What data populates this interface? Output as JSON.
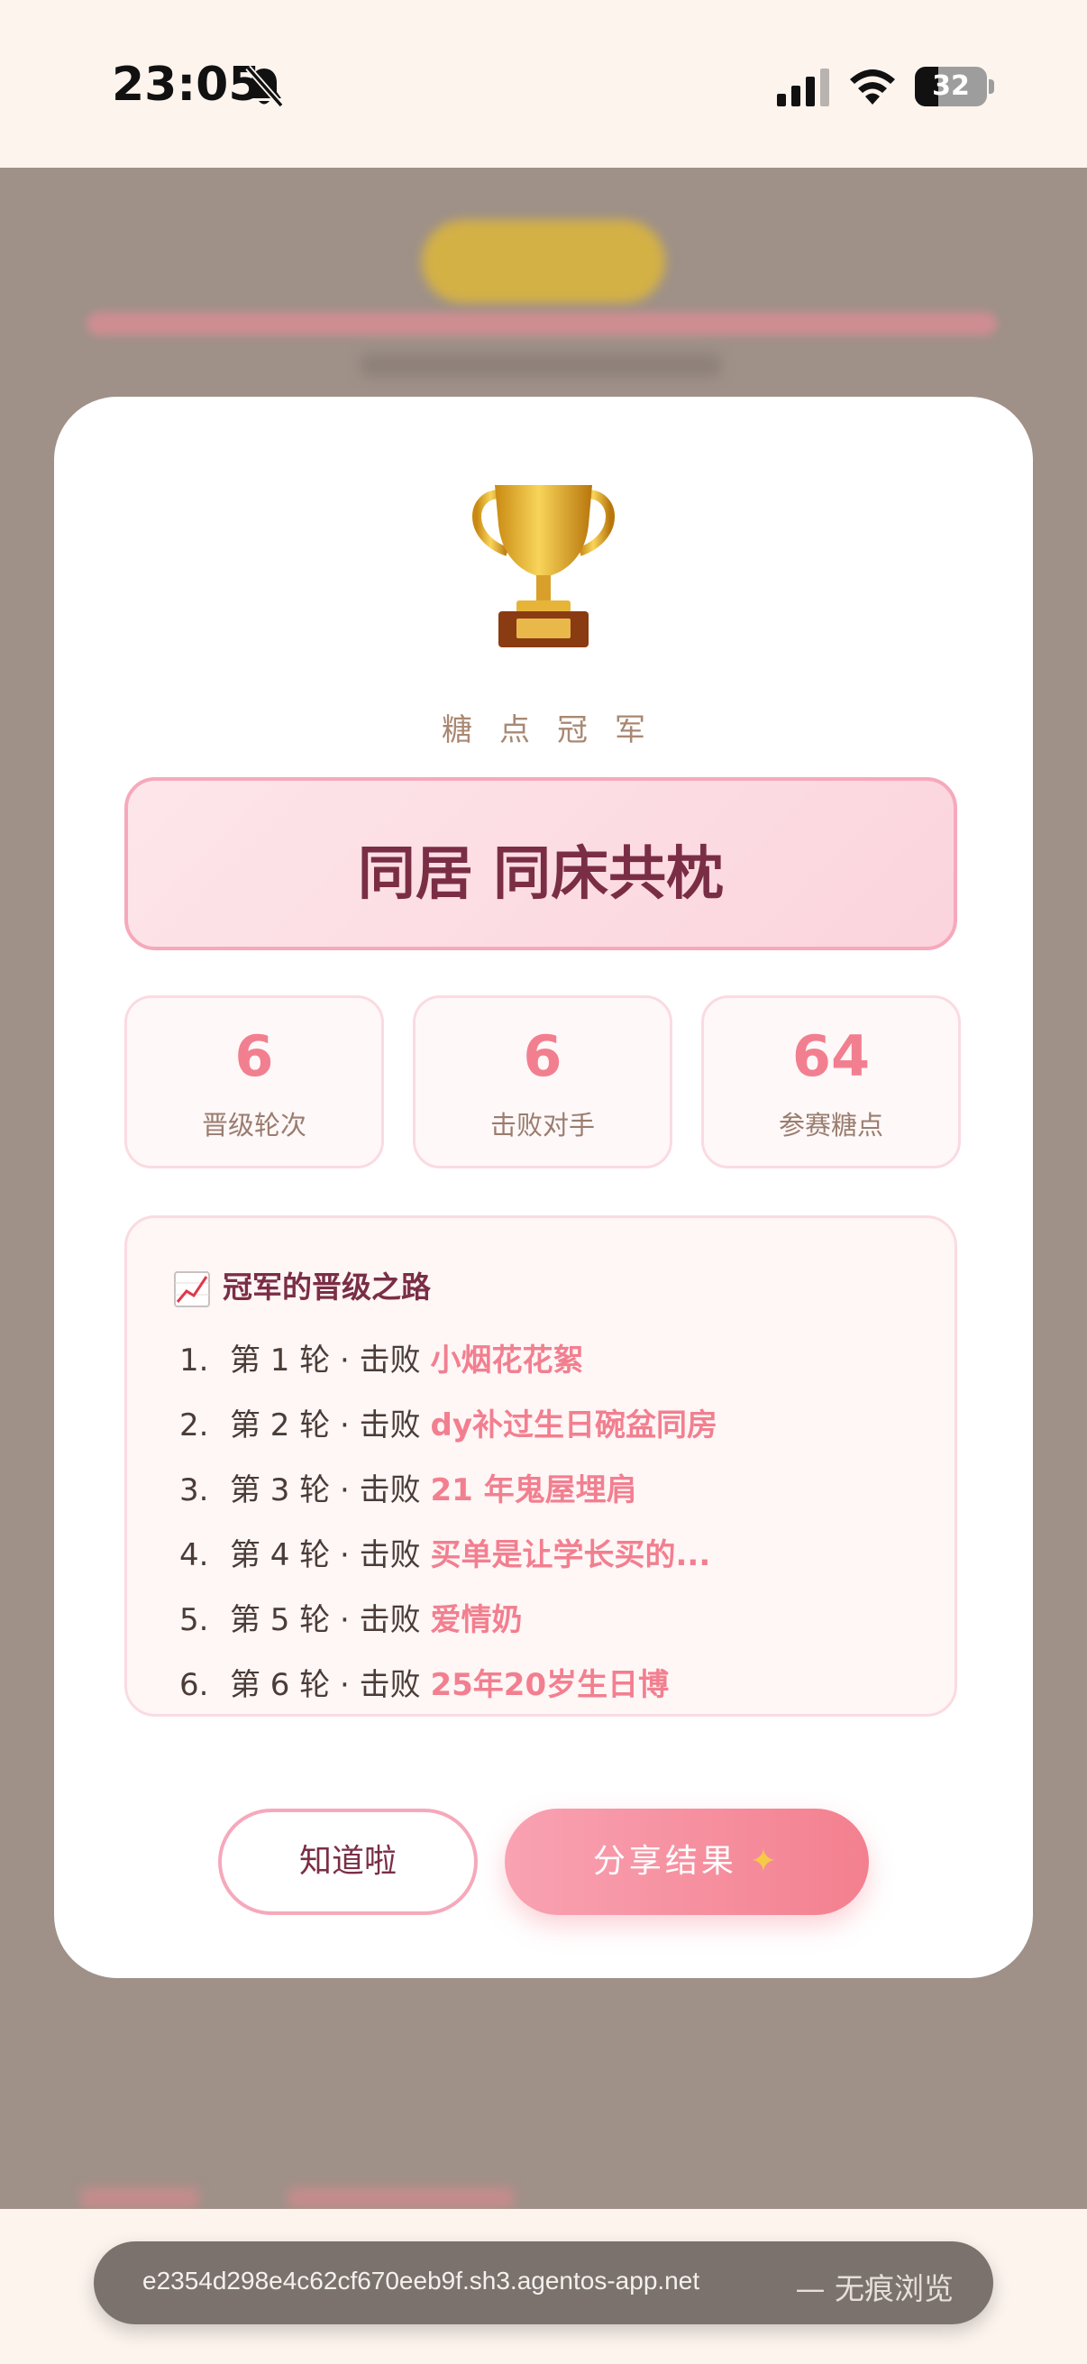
{
  "status_bar": {
    "time": "23:05",
    "battery": "32",
    "icons": [
      "bell-slash-icon",
      "signal-icon",
      "wifi-icon",
      "battery-icon"
    ]
  },
  "modal": {
    "trophy_icon": "trophy-icon",
    "subtitle": "糖点冠军",
    "champion_name": "同居 同床共枕",
    "stats": [
      {
        "value": "6",
        "label": "晋级轮次"
      },
      {
        "value": "6",
        "label": "击败对手"
      },
      {
        "value": "64",
        "label": "参赛糖点"
      }
    ],
    "path": {
      "icon": "chart-increasing-icon",
      "title": "冠军的晋级之路",
      "rounds": [
        {
          "index": "1.",
          "text": "第 1 轮 · 击败",
          "opponent": "小烟花花絮"
        },
        {
          "index": "2.",
          "text": "第 2 轮 · 击败",
          "opponent": "dy补过生日碗盆同房"
        },
        {
          "index": "3.",
          "text": "第 3 轮 · 击败",
          "opponent": "21 年鬼屋埋肩"
        },
        {
          "index": "4.",
          "text": "第 4 轮 · 击败",
          "opponent": "买单是让学长买的..."
        },
        {
          "index": "5.",
          "text": "第 5 轮 · 击败",
          "opponent": "爱情奶"
        },
        {
          "index": "6.",
          "text": "第 6 轮 · 击败",
          "opponent": "25年20岁生日博"
        }
      ]
    },
    "buttons": {
      "ok": "知道啦",
      "share": "分享结果",
      "share_icon": "sparkles-icon"
    }
  },
  "browser": {
    "url": "e2354d298e4c62cf670eeb9f.sh3.agentos-app.net",
    "mode": "— 无痕浏览"
  },
  "colors": {
    "accent": "#f27f8f",
    "title": "#7a2e45",
    "background": "#fdf4ee"
  }
}
